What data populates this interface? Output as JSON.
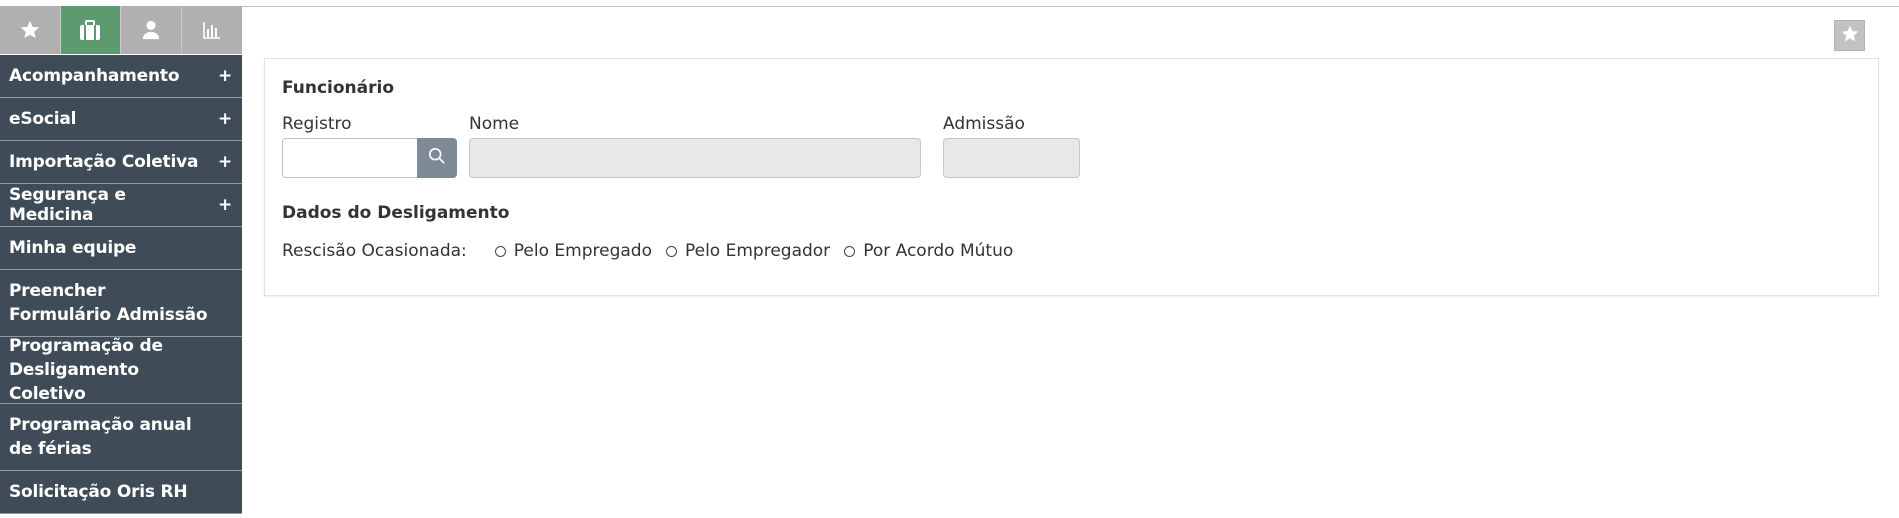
{
  "sidebar": {
    "tabs": [
      {
        "icon": "star-icon",
        "active": false
      },
      {
        "icon": "briefcase-icon",
        "active": true
      },
      {
        "icon": "user-icon",
        "active": false
      },
      {
        "icon": "bar-chart-icon",
        "active": false
      }
    ],
    "items": [
      {
        "label": "Acompanhamento",
        "expandable": "+"
      },
      {
        "label": "eSocial",
        "expandable": "+"
      },
      {
        "label": "Importação Coletiva",
        "expandable": "+"
      },
      {
        "label": "Segurança e Medicina",
        "expandable": "+"
      },
      {
        "label": "Minha equipe"
      },
      {
        "label": "Preencher Formulário Admissão"
      },
      {
        "label": "Programação de Desligamento Coletivo"
      },
      {
        "label": "Programação anual de férias"
      },
      {
        "label": "Solicitação Oris RH"
      }
    ]
  },
  "form": {
    "section_employee": "Funcionário",
    "registro_label": "Registro",
    "registro_value": "",
    "nome_label": "Nome",
    "nome_value": "",
    "admissao_label": "Admissão",
    "admissao_value": "",
    "section_termination": "Dados do Desligamento",
    "rescisao_label": "Rescisão Ocasionada:",
    "rescisao_options": [
      "Pelo Empregado",
      "Pelo Empregador",
      "Por Acordo Mútuo"
    ]
  },
  "colors": {
    "sidebar_bg": "#3f4b57",
    "tab_active": "#5e9a6f",
    "tab_inactive": "#b0b0b0",
    "search_button": "#7e8b97"
  }
}
